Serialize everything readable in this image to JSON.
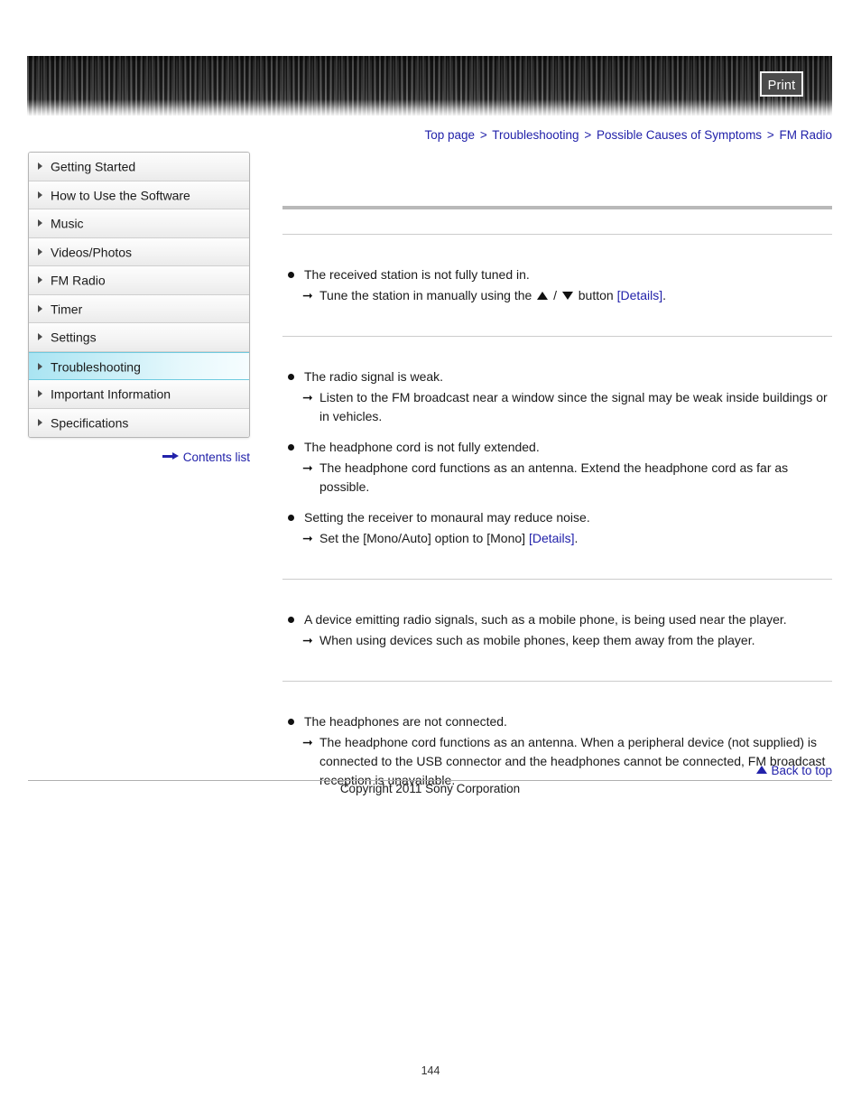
{
  "header": {
    "print_label": "Print"
  },
  "breadcrumb": {
    "separator": ">",
    "items": [
      {
        "label": "Top page"
      },
      {
        "label": "Troubleshooting"
      },
      {
        "label": "Possible Causes of Symptoms"
      },
      {
        "label": "FM Radio"
      }
    ]
  },
  "sidebar": {
    "items": [
      {
        "label": "Getting Started",
        "active": false
      },
      {
        "label": "How to Use the Software",
        "active": false
      },
      {
        "label": "Music",
        "active": false
      },
      {
        "label": "Videos/Photos",
        "active": false
      },
      {
        "label": "FM Radio",
        "active": false
      },
      {
        "label": "Timer",
        "active": false
      },
      {
        "label": "Settings",
        "active": false
      },
      {
        "label": "Troubleshooting",
        "active": true
      },
      {
        "label": "Important Information",
        "active": false
      },
      {
        "label": "Specifications",
        "active": false
      }
    ],
    "contents_link": "Contents list",
    "contents_icon": "right-arrow-icon",
    "active_background": "#a9e4f2",
    "active_border": "#6ecbe0"
  },
  "main": {
    "blocks": [
      {
        "items": [
          {
            "cause": "The received station is not fully tuned in.",
            "remedy_pre": "Tune the station in manually using the",
            "remedy_icons": [
              "triangle-up-icon",
              "triangle-down-icon"
            ],
            "remedy_mid": "button",
            "remedy_link": "[Details]",
            "remedy_post": "."
          }
        ]
      },
      {
        "items": [
          {
            "cause": "The radio signal is weak.",
            "remedy": "Listen to the FM broadcast near a window since the signal may be weak inside buildings or in vehicles."
          },
          {
            "cause": "The headphone cord is not fully extended.",
            "remedy": "The headphone cord functions as an antenna. Extend the headphone cord as far as possible."
          },
          {
            "cause": "Setting the receiver to monaural may reduce noise.",
            "remedy_pre": "Set the [Mono/Auto] option to [Mono]",
            "remedy_link": "[Details]",
            "remedy_post": "."
          }
        ]
      },
      {
        "items": [
          {
            "cause": "A device emitting radio signals, such as a mobile phone, is being used near the player.",
            "remedy": "When using devices such as mobile phones, keep them away from the player."
          }
        ]
      },
      {
        "items": [
          {
            "cause": "The headphones are not connected.",
            "remedy": "The headphone cord functions as an antenna. When a peripheral device (not supplied) is connected to the USB connector and the headphones cannot be connected, FM broadcast reception is unavailable."
          }
        ]
      }
    ]
  },
  "footer": {
    "back_to_top": "Back to top",
    "back_to_top_icon": "triangle-up-icon",
    "copyright": "Copyright 2011 Sony Corporation",
    "page_number": "144"
  },
  "colors": {
    "link": "#2222aa",
    "rule_thick": "#b9b9b9",
    "rule_thin": "#cccccc",
    "header_dark": "#3a3a3a"
  }
}
